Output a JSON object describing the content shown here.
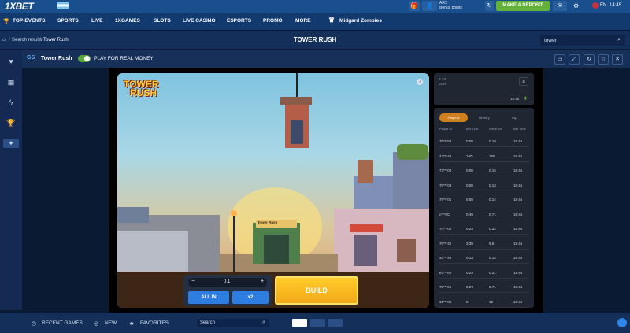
{
  "header": {
    "logo": "1XBET",
    "account_currency": "ARS",
    "bonus_label": "Bonus points",
    "deposit_label": "MAKE A DEPOSIT",
    "language": "EN",
    "time": "14:45"
  },
  "nav": {
    "items": [
      "TOP-EVENTS",
      "SPORTS",
      "LIVE",
      "1XGAMES",
      "SLOTS",
      "LIVE CASINO",
      "ESPORTS",
      "PROMO",
      "MORE"
    ],
    "promo_label": "Midgard Zombies"
  },
  "breadcrumb": [
    "Search results",
    "Tower Rush"
  ],
  "page_title": "TOWER RUSH",
  "search_value": "tower",
  "game_header": {
    "provider": "GS",
    "name": "Tower Rush",
    "real_money_label": "PLAY FOR REAL MONEY"
  },
  "game": {
    "logo_line1": "TOWER",
    "logo_line2": "RUSH",
    "shop_sign": "Tower Rush",
    "balance": "0 · 0",
    "balance_currency": "EUR",
    "clock": "18:45",
    "bet_value": "0.1",
    "all_in_label": "ALL IN",
    "x2_label": "x2",
    "build_label": "BUILD",
    "tabs": [
      "Players",
      "History",
      "Top"
    ],
    "columns": [
      "Player ID",
      "Bet EUR",
      "Win EUR",
      "Bet Time"
    ],
    "rows": [
      [
        "70***84",
        "0.08",
        "0.19",
        "18:45"
      ],
      [
        "43***48",
        "100",
        "165",
        "18:45"
      ],
      [
        "72***00",
        "0.08",
        "0.15",
        "18:45"
      ],
      [
        "70***08",
        "0.08",
        "0.13",
        "18:45"
      ],
      [
        "70***01",
        "0.08",
        "0.14",
        "18:45"
      ],
      [
        "c***0C",
        "0.45",
        "0.71",
        "18:45"
      ],
      [
        "70***02",
        "0.24",
        "0.32",
        "18:45"
      ],
      [
        "70***42",
        "3.39",
        "9.5",
        "18:45"
      ],
      [
        "40***48",
        "0.12",
        "0.15",
        "18:45"
      ],
      [
        "e3***e0",
        "0.24",
        "0.31",
        "18:45"
      ],
      [
        "70***66",
        "0.27",
        "0.71",
        "18:45"
      ],
      [
        "31***82",
        "5",
        "12",
        "18:45"
      ]
    ]
  },
  "footer": {
    "recent": "RECENT GAMES",
    "new": "NEW",
    "favorites": "FAVORITES",
    "search_placeholder": "Search"
  }
}
